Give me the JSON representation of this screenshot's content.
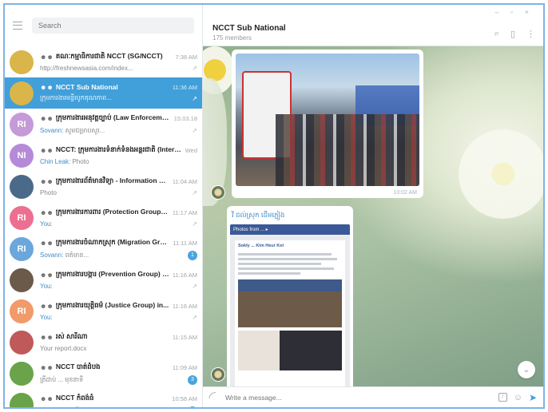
{
  "window": {
    "controls": "– ▫ ×"
  },
  "sidebar": {
    "search_placeholder": "Search",
    "chats": [
      {
        "name": "គណៈកម្មាធិការជាតិ NCCT (SG/NCCT)",
        "time": "7:38 AM",
        "preview_sender": "",
        "preview": "http://freshnewsasia.com/index...",
        "avatar_text": "",
        "avatar_color": "#d9b54a",
        "pinned": true,
        "badge": ""
      },
      {
        "name": "NCCT Sub National",
        "time": "11:36 AM",
        "preview_sender": "",
        "preview": "ក្រុមការងារមន្ទីរបូកគុណភាព...",
        "avatar_text": "",
        "avatar_color": "#d9b54a",
        "pinned": true,
        "badge": "",
        "active": true
      },
      {
        "name": "ក្រុមការងារអនុវត្តច្បាប់ (Law Enforcement Grou...",
        "time": "15.03.18",
        "preview_sender": "Sovann: ",
        "preview": "សូមជម្រាបសួរ...",
        "avatar_text": "RI",
        "avatar_color": "#c59ad9",
        "pinned": true,
        "badge": ""
      },
      {
        "name": "NCCT: ក្រុមការងារទំនាក់ទំនងអន្តរជាតិ (International R...",
        "time": "Wed",
        "preview_sender": "Chin Leak: ",
        "preview": "Photo",
        "avatar_text": "NI",
        "avatar_color": "#b58ad8",
        "pinned": false,
        "badge": ""
      },
      {
        "name": "ក្រុមការងារព័ត៌មានវិទ្យា - Information Group",
        "time": "11:04 AM",
        "preview_sender": "",
        "preview": "Photo",
        "avatar_text": "",
        "avatar_color": "#4b6a8a",
        "pinned": true,
        "badge": ""
      },
      {
        "name": "ក្រុមការងារការពារ (Protection Group) i...",
        "time": "11:17 AM",
        "preview_sender": "You: ",
        "preview": "",
        "avatar_text": "RI",
        "avatar_color": "#ec6f8f",
        "pinned": true,
        "badge": ""
      },
      {
        "name": "ក្រុមការងារចំណាកស្រុក (Migration Group) internal",
        "time": "11:11 AM",
        "preview_sender": "Sovann: ",
        "preview": "ពត៌មាន...",
        "avatar_text": "RI",
        "avatar_color": "#6ba7dc",
        "pinned": false,
        "badge": "1"
      },
      {
        "name": "ក្រុមការងារបង្ការ (Prevention Group) int...",
        "time": "11:16 AM",
        "preview_sender": "You: ",
        "preview": "",
        "avatar_text": "",
        "avatar_color": "#6b5a4a",
        "pinned": true,
        "badge": ""
      },
      {
        "name": "ក្រុមការងារយុត្តិធម៌ (Justice Group) in...",
        "time": "11:16 AM",
        "preview_sender": "You: ",
        "preview": "",
        "avatar_text": "RI",
        "avatar_color": "#f19a6a",
        "pinned": true,
        "badge": ""
      },
      {
        "name": "រស់ សារីណា",
        "time": "11:15 AM",
        "preview_sender": "",
        "preview": "Your report.docx",
        "avatar_text": "",
        "avatar_color": "#c05a5a",
        "pinned": false,
        "badge": ""
      },
      {
        "name": "NCCT បាត់ដំបង",
        "time": "11:09 AM",
        "preview_sender": "",
        "preview": "ត្រីដាប់ ... មុខនាទី",
        "avatar_text": "",
        "avatar_color": "#6aa34a",
        "pinned": false,
        "badge": "3"
      },
      {
        "name": "NCCT កំពង់ធំ",
        "time": "10:58 AM",
        "preview_sender": "",
        "preview": "ស៊ាន ... មុខនាទី",
        "avatar_text": "",
        "avatar_color": "#6aa34a",
        "pinned": false,
        "badge": "8"
      }
    ]
  },
  "header": {
    "title": "NCCT Sub National",
    "subtitle": "175 members"
  },
  "messages": {
    "photo_time": "10:02 AM",
    "caption": "វិ ដល់ស្រុក ដើមភ្ជៀង",
    "fb_bar": "Photos from ... ▸",
    "fb_author": "Sokly ... Kim Heur Ket"
  },
  "composer": {
    "placeholder": "Write a message..."
  },
  "icons": {
    "menu": "menu-icon",
    "search": "search-icon",
    "sidebar": "sidebar-toggle-icon",
    "more": "more-icon",
    "attach": "paperclip-icon",
    "commands": "commands-icon",
    "emoji": "emoji-icon",
    "send": "send-icon",
    "scroll": "chevron-down-icon"
  }
}
